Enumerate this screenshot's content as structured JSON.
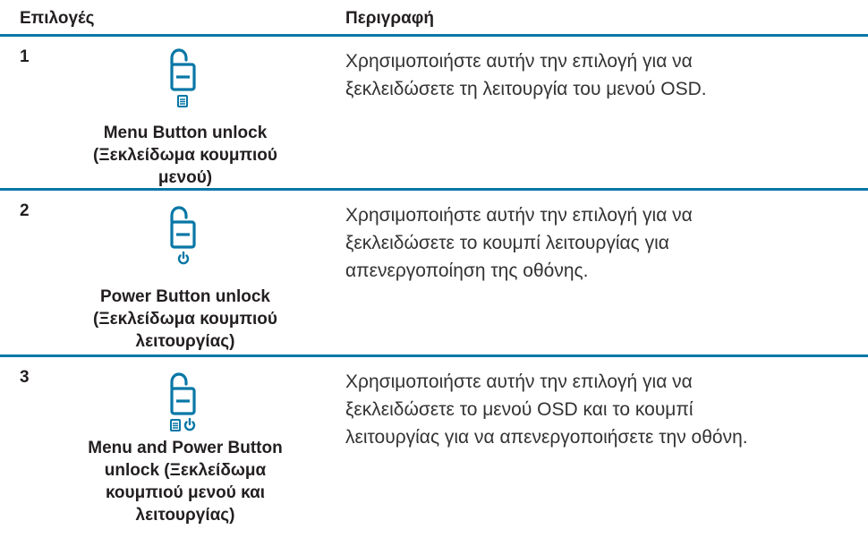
{
  "header": {
    "options": "Επιλογές",
    "description": "Περιγραφή"
  },
  "colors": {
    "accent": "#0877a6",
    "text": "#231f20"
  },
  "rows": [
    {
      "number": "1",
      "icon": "lock-open-menu-icon",
      "label_lines": [
        "Menu Button unlock",
        "(Ξεκλείδωμα κουμπιού",
        "μενού)"
      ],
      "description_lines": [
        "Χρησιμοποιήστε αυτήν την επιλογή για να",
        "ξεκλειδώσετε τη λειτουργία του μενού OSD."
      ]
    },
    {
      "number": "2",
      "icon": "lock-open-power-icon",
      "label_lines": [
        "Power Button unlock",
        "(Ξεκλείδωμα κουμπιού",
        "λειτουργίας)"
      ],
      "description_lines": [
        "Χρησιμοποιήστε αυτήν την επιλογή για να",
        "ξεκλειδώσετε το κουμπί λειτουργίας για",
        "απενεργοποίηση της οθόνης."
      ]
    },
    {
      "number": "3",
      "icon": "lock-open-menu-power-icon",
      "label_lines": [
        "Menu and Power Button",
        "unlock (Ξεκλείδωμα",
        "κουμπιού μενού και",
        "λειτουργίας)"
      ],
      "description_lines": [
        "Χρησιμοποιήστε αυτήν την επιλογή για να",
        "ξεκλειδώσετε το μενού OSD και το κουμπί",
        "λειτουργίας για να απενεργοποιήσετε την οθόνη."
      ]
    }
  ]
}
